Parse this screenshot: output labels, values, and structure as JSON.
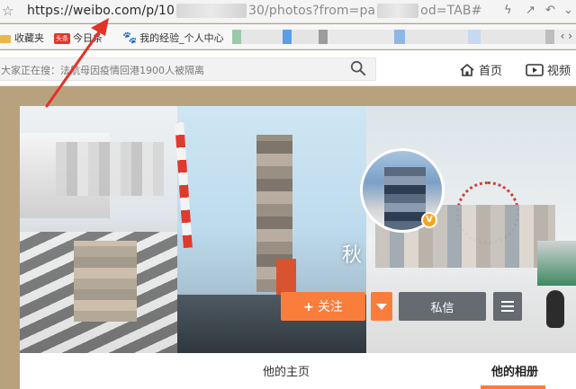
{
  "browser": {
    "url_visible": "https://weibo.com/p/10",
    "url_mid": "30/photos?from=pa",
    "url_tail": "od=TAB#",
    "bookmarks": [
      {
        "label": "收藏夹",
        "icon": "folder-icon"
      },
      {
        "label": "今日",
        "badge": "头条",
        "suffix": "条",
        "icon": "toutiao-icon"
      },
      {
        "label": "我的经验_个人中心",
        "icon": "paw-icon"
      }
    ]
  },
  "weibo_nav": {
    "search_placeholder": "大家正在搜：法航母因疫情回港1900人被隔离",
    "home_label": "首页",
    "video_label": "视频"
  },
  "profile": {
    "nickname_initial": "秋",
    "verified_badge": "V",
    "follow_label": "关注",
    "follow_plus": "+",
    "message_label": "私信"
  },
  "tabs": [
    {
      "label": "他的主页",
      "active": false
    },
    {
      "label": "他的相册",
      "active": true
    }
  ],
  "colors": {
    "accent_orange": "#fa7d3c",
    "button_gray": "#666b72",
    "annotation_red": "#e0342a",
    "page_background": "#b8a27e"
  }
}
